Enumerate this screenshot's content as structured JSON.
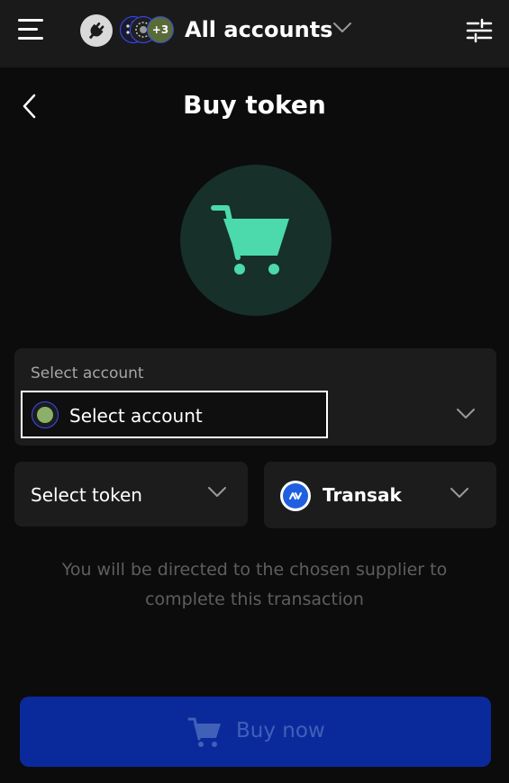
{
  "header": {
    "title": "All accounts",
    "extra_accounts_badge": "+3"
  },
  "page": {
    "title": "Buy token"
  },
  "account": {
    "label": "Select account",
    "value": "Select account"
  },
  "token": {
    "label": "Select token"
  },
  "provider": {
    "name": "Transak"
  },
  "info": {
    "text": "You will be directed to the chosen supplier to complete this transaction"
  },
  "actions": {
    "buy_label": "Buy now"
  },
  "colors": {
    "accent_green": "#4cd9ac",
    "primary_button": "#0a2a9c",
    "provider_blue": "#1f5fe0"
  }
}
